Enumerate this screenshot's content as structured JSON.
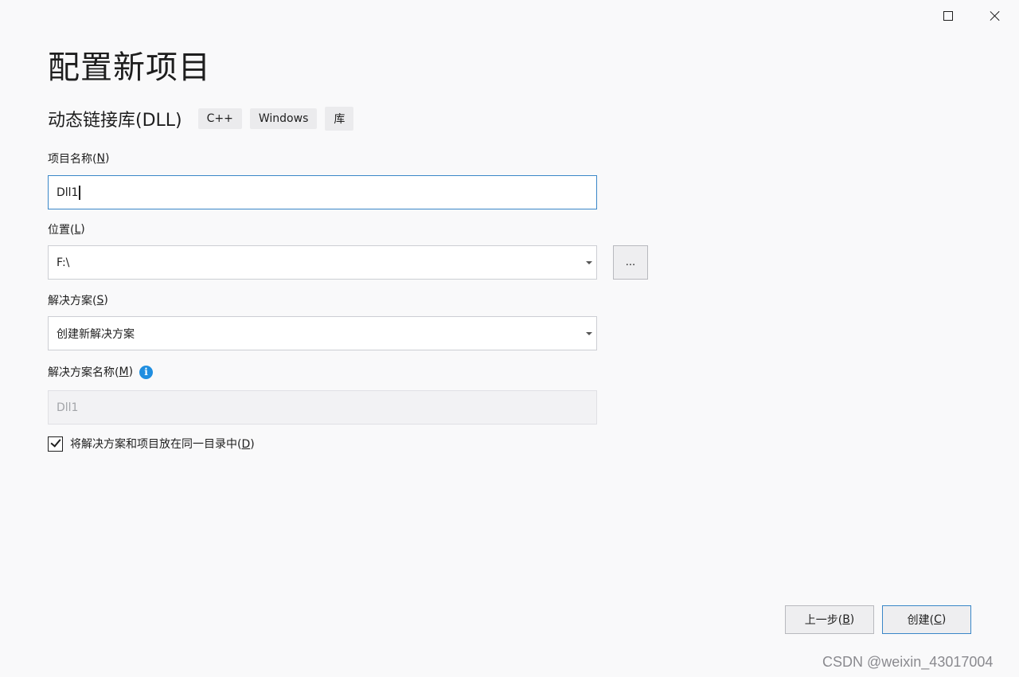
{
  "window": {
    "maximize_icon": "maximize-icon",
    "close_icon": "close-icon"
  },
  "header": {
    "title": "配置新项目"
  },
  "template": {
    "name": "动态链接库(DLL)",
    "tags": [
      "C++",
      "Windows",
      "库"
    ]
  },
  "form": {
    "project_name": {
      "label": "项目名称(",
      "key": "N",
      "label_end": ")",
      "value": "Dll1"
    },
    "location": {
      "label": "位置(",
      "key": "L",
      "label_end": ")",
      "value": "F:\\",
      "browse_label": "..."
    },
    "solution": {
      "label": "解决方案(",
      "key": "S",
      "label_end": ")",
      "value": "创建新解决方案"
    },
    "solution_name": {
      "label": "解决方案名称(",
      "key": "M",
      "label_end": ")",
      "value": "Dll1",
      "info_glyph": "i"
    },
    "same_dir": {
      "label": "将解决方案和项目放在同一目录中(",
      "key": "D",
      "label_end": ")",
      "checked": true
    }
  },
  "footer": {
    "back": {
      "label": "上一步(",
      "key": "B",
      "label_end": ")"
    },
    "create": {
      "label": "创建(",
      "key": "C",
      "label_end": ")"
    }
  },
  "watermark": "CSDN @weixin_43017004"
}
